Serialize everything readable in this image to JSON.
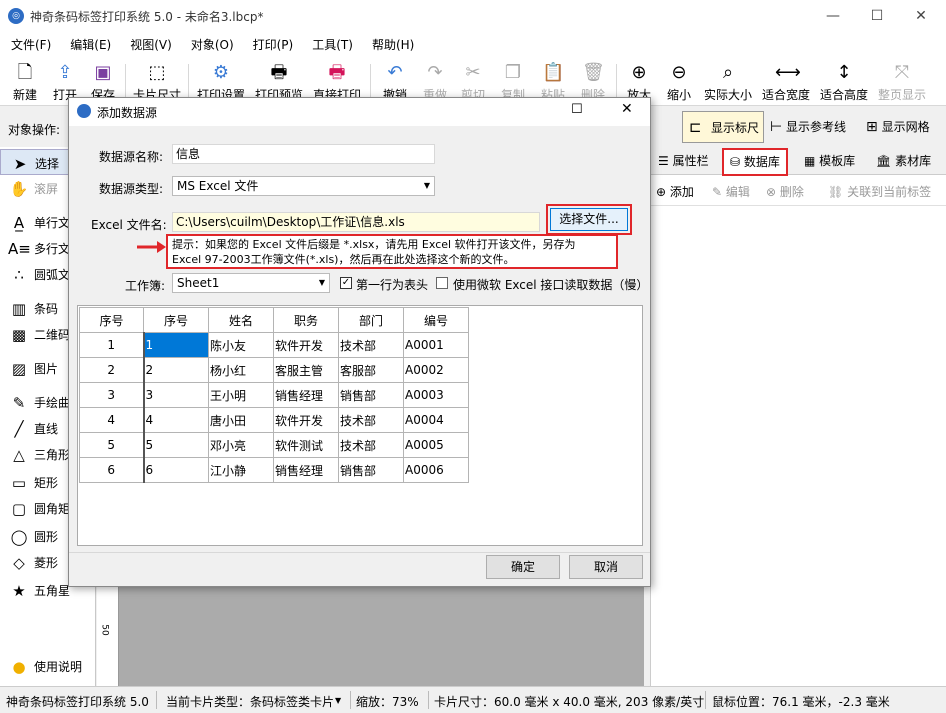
{
  "window": {
    "title": "神奇条码标签打印系统 5.0 - 未命名3.lbcp*"
  },
  "menu": [
    "文件(F)",
    "编辑(E)",
    "视图(V)",
    "对象(O)",
    "打印(P)",
    "工具(T)",
    "帮助(H)"
  ],
  "toolbar": {
    "new": "新建",
    "open": "打开",
    "save": "保存",
    "card_size": "卡片尺寸",
    "print_setup": "打印设置",
    "print_preview": "打印预览",
    "direct_print": "直接打印",
    "undo": "撤销",
    "redo": "重做",
    "cut": "剪切",
    "copy": "复制",
    "paste": "粘贴",
    "delete": "删除",
    "zoom_in": "放大",
    "zoom_out": "缩小",
    "actual_size": "实际大小",
    "fit_width": "适合宽度",
    "fit_height": "适合高度",
    "fit_page": "整页显示"
  },
  "object_ops": {
    "label": "对象操作:",
    "show_ruler": "显示标尺",
    "show_guides": "显示参考线",
    "show_grid": "显示网格"
  },
  "left_tools": [
    "选择",
    "滚屏",
    "单行文",
    "多行文",
    "圆弧文",
    "条码",
    "二维码",
    "图片",
    "手绘曲",
    "直线",
    "三角形",
    "矩形",
    "圆角矩",
    "圆形",
    "菱形",
    "五角星",
    "使用说明"
  ],
  "ruler_label": "50",
  "right_panel": {
    "tabs": [
      "属性栏",
      "数据库",
      "模板库",
      "素材库"
    ],
    "actions": [
      "添加",
      "编辑",
      "删除",
      "关联到当前标签"
    ]
  },
  "dialog": {
    "title": "添加数据源",
    "name_label": "数据源名称:",
    "name_value": "信息",
    "type_label": "数据源类型:",
    "type_value": "MS Excel 文件",
    "file_label": "Excel 文件名:",
    "file_value": "C:\\Users\\cuilm\\Desktop\\工作证\\信息.xls",
    "choose_button": "选择文件...",
    "hint_line1": "提示：如果您的 Excel 文件后缀是 *.xlsx，请先用 Excel 软件打开该文件，另存为",
    "hint_line2": "Excel 97-2003工作簿文件(*.xls)，然后再在此处选择这个新的文件。",
    "sheet_label": "工作簿:",
    "sheet_value": "Sheet1",
    "first_row_header": "第一行为表头",
    "first_row_checked": true,
    "use_ms_interface": "使用微软 Excel 接口读取数据（慢）",
    "use_ms_checked": false,
    "columns": [
      "序号",
      "序号",
      "姓名",
      "职务",
      "部门",
      "编号"
    ],
    "rows": [
      [
        "1",
        "1",
        "陈小友",
        "软件开发",
        "技术部",
        "A0001"
      ],
      [
        "2",
        "2",
        "杨小红",
        "客服主管",
        "客服部",
        "A0002"
      ],
      [
        "3",
        "3",
        "王小明",
        "销售经理",
        "销售部",
        "A0003"
      ],
      [
        "4",
        "4",
        "唐小田",
        "软件开发",
        "技术部",
        "A0004"
      ],
      [
        "5",
        "5",
        "邓小亮",
        "软件测试",
        "技术部",
        "A0005"
      ],
      [
        "6",
        "6",
        "江小静",
        "销售经理",
        "销售部",
        "A0006"
      ]
    ],
    "ok": "确定",
    "cancel": "取消"
  },
  "status": {
    "app": "神奇条码标签打印系统 5.0",
    "card_type": "当前卡片类型：条码标签类卡片",
    "zoom": "缩放：73%",
    "card_size": "卡片尺寸：60.0 毫米 x 40.0 毫米, 203 像素/英寸",
    "mouse": "鼠标位置：76.1 毫米，-2.3 毫米"
  },
  "colors": {
    "accent": "#0078d7",
    "highlight_red": "#e0262a",
    "path_bg": "#fffde0"
  }
}
